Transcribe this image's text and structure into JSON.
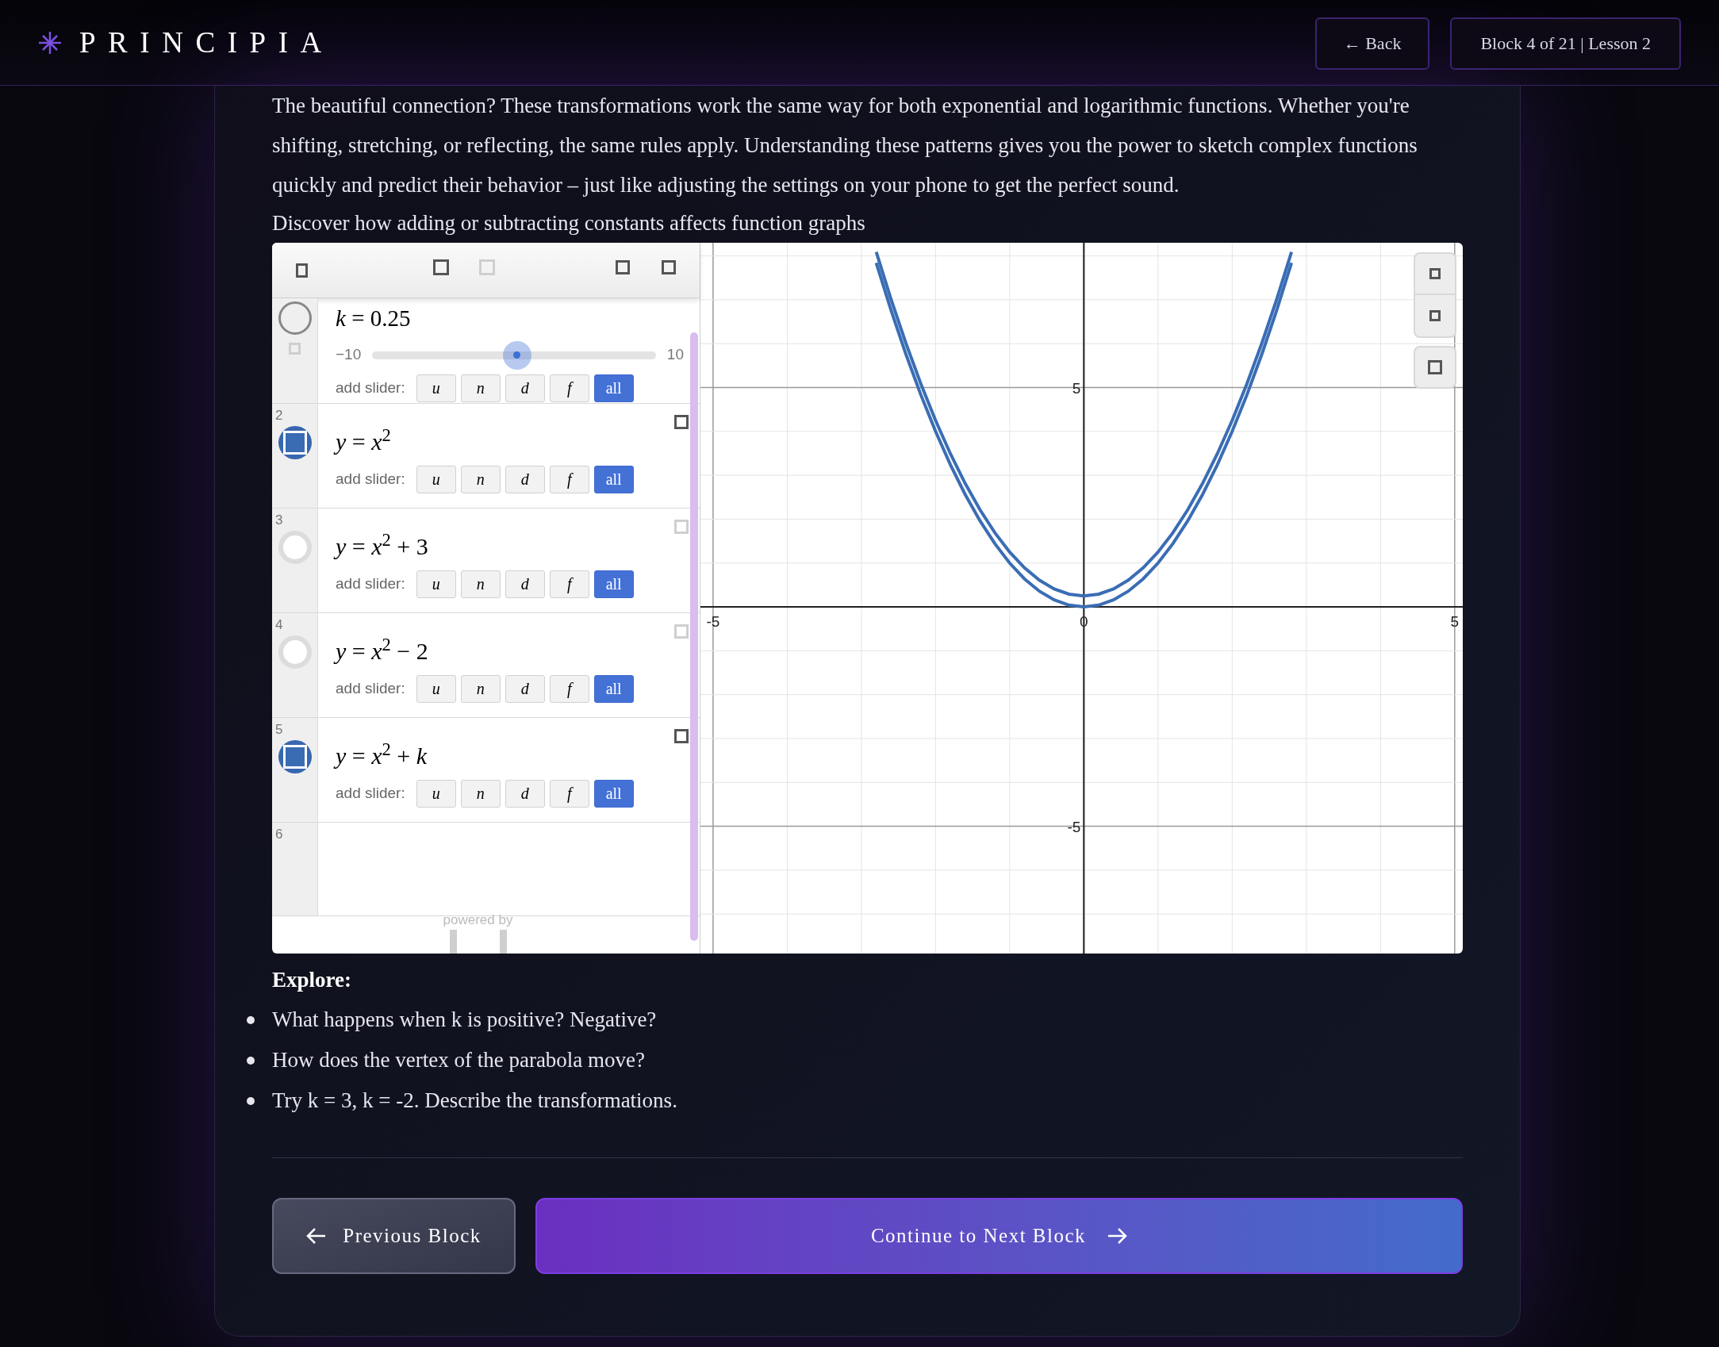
{
  "header": {
    "logo": "PRINCIPIA",
    "back_button": "← Back",
    "progress": "Block 4 of 21 | Lesson 2"
  },
  "intro_paragraph": "The beautiful connection? These transformations work the same way for both exponential and logarithmic functions. Whether you're shifting, stretching, or reflecting, the same rules apply. Understanding these patterns gives you the power to sketch complex functions quickly and predict their behavior – just like adjusting the settings on your phone to get the perfect sound.",
  "subtitle": "Discover how adding or subtracting constants affects function graphs",
  "calculator": {
    "expressions": [
      {
        "kind": "slider",
        "latex": "*k* = 0.25",
        "min": "−10",
        "max": "10",
        "level": 0.51,
        "add_slider_label": "add slider:",
        "slider_buttons": [
          {
            "label": "u",
            "selected": false
          },
          {
            "label": "n",
            "selected": false
          },
          {
            "label": "d",
            "selected": false
          },
          {
            "label": "f",
            "selected": false
          },
          {
            "label": "all",
            "selected": true
          }
        ]
      },
      {
        "kind": "expression",
        "number": "2",
        "visible": true,
        "latex": "*y* = *x*$^{2}$",
        "add_slider_label": "add slider:",
        "slider_buttons": [
          {
            "label": "u",
            "selected": false
          },
          {
            "label": "n",
            "selected": false
          },
          {
            "label": "d",
            "selected": false
          },
          {
            "label": "f",
            "selected": false
          },
          {
            "label": "all",
            "selected": true
          }
        ]
      },
      {
        "kind": "expression",
        "number": "3",
        "visible": false,
        "latex": "*y* = *x*$^{2}$ + 3",
        "add_slider_label": "add slider:",
        "slider_buttons": [
          {
            "label": "u",
            "selected": false
          },
          {
            "label": "n",
            "selected": false
          },
          {
            "label": "d",
            "selected": false
          },
          {
            "label": "f",
            "selected": false
          },
          {
            "label": "all",
            "selected": true
          }
        ]
      },
      {
        "kind": "expression",
        "number": "4",
        "visible": false,
        "latex": "*y* = *x*$^{2}$ − 2",
        "add_slider_label": "add slider:",
        "slider_buttons": [
          {
            "label": "u",
            "selected": false
          },
          {
            "label": "n",
            "selected": false
          },
          {
            "label": "d",
            "selected": false
          },
          {
            "label": "f",
            "selected": false
          },
          {
            "label": "all",
            "selected": true
          }
        ]
      },
      {
        "kind": "expression",
        "number": "5",
        "visible": true,
        "latex": "*y* = *x*$^{2}$ + *k*",
        "add_slider_label": "add slider:",
        "slider_buttons": [
          {
            "label": "u",
            "selected": false
          },
          {
            "label": "n",
            "selected": false
          },
          {
            "label": "d",
            "selected": false
          },
          {
            "label": "f",
            "selected": false
          },
          {
            "label": "all",
            "selected": true
          }
        ]
      },
      {
        "kind": "empty",
        "number": "6"
      }
    ],
    "powered_by": "powered by",
    "graph": {
      "chart_data": {
        "type": "line",
        "x": [
          -2.8,
          -2.6,
          -2.4,
          -2.2,
          -2,
          -1.8,
          -1.6,
          -1.4,
          -1.2,
          -1,
          -0.8,
          -0.6,
          -0.4,
          -0.2,
          0,
          0.2,
          0.4,
          0.6,
          0.8,
          1,
          1.2,
          1.4,
          1.6,
          1.8,
          2,
          2.2,
          2.4,
          2.6,
          2.8
        ],
        "xlim": [
          -5.17,
          5.12
        ],
        "ylim": [
          -7.9,
          8.3
        ],
        "grid": true,
        "xticks": [
          -5,
          0,
          5
        ],
        "yticks": [
          -5,
          5
        ],
        "series": [
          {
            "color": "#3a6db4",
            "values": [
              7.84,
              6.76,
              5.76,
              4.84,
              4,
              3.24,
              2.56,
              1.96,
              1.44,
              1,
              0.64,
              0.36,
              0.16,
              0.04,
              0,
              0.04,
              0.16,
              0.36,
              0.64,
              1,
              1.44,
              1.96,
              2.56,
              3.24,
              4,
              4.84,
              5.76,
              6.76,
              7.84
            ]
          },
          {
            "color": "#3a6db4",
            "values": [
              8.09,
              7.01,
              6.01,
              5.09,
              4.25,
              3.49,
              2.81,
              2.21,
              1.69,
              1.25,
              0.89,
              0.61,
              0.41,
              0.29,
              0.25,
              0.29,
              0.41,
              0.61,
              0.89,
              1.25,
              1.69,
              2.21,
              2.81,
              3.49,
              4.25,
              5.09,
              6.01,
              7.01,
              8.09
            ]
          }
        ]
      }
    }
  },
  "explore": {
    "heading": "Explore:",
    "items": [
      "What happens when k is positive? Negative?",
      "How does the vertex of the parabola move?",
      "Try k = 3, k = -2. Describe the transformations."
    ]
  },
  "nav": {
    "previous": "Previous Block",
    "next": "Continue to Next Block"
  }
}
